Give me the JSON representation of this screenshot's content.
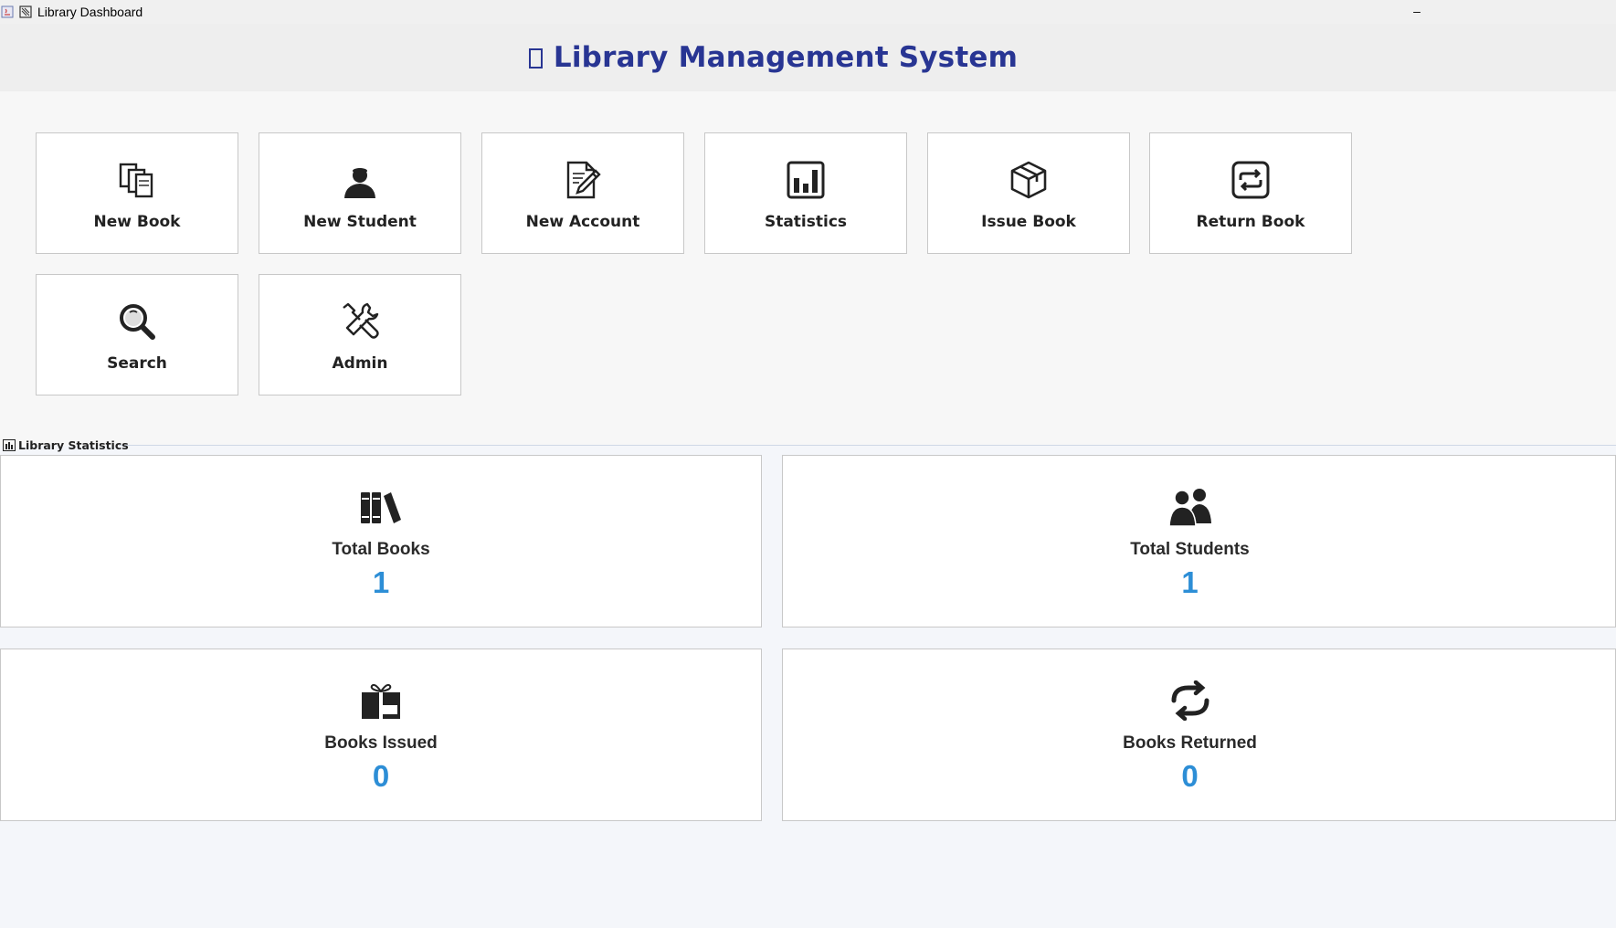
{
  "window": {
    "title": "Library Dashboard",
    "minimize_label": "–"
  },
  "header": {
    "title": "Library Management System",
    "title_color": "#283593"
  },
  "tiles": [
    {
      "label": "New Book",
      "icon": "books-copy-icon"
    },
    {
      "label": "New Student",
      "icon": "student-icon"
    },
    {
      "label": "New Account",
      "icon": "edit-document-icon"
    },
    {
      "label": "Statistics",
      "icon": "bar-chart-icon"
    },
    {
      "label": "Issue Book",
      "icon": "package-icon"
    },
    {
      "label": "Return Book",
      "icon": "repeat-icon"
    },
    {
      "label": "Search",
      "icon": "magnifier-icon"
    },
    {
      "label": "Admin",
      "icon": "tools-icon"
    }
  ],
  "stats": {
    "section_title": "Library Statistics",
    "value_color": "#2d8ed6",
    "cards": [
      {
        "label": "Total Books",
        "value": "1",
        "icon": "books-shelf-icon"
      },
      {
        "label": "Total Students",
        "value": "1",
        "icon": "people-icon"
      },
      {
        "label": "Books Issued",
        "value": "0",
        "icon": "gift-box-icon"
      },
      {
        "label": "Books Returned",
        "value": "0",
        "icon": "cycle-arrows-icon"
      }
    ]
  }
}
